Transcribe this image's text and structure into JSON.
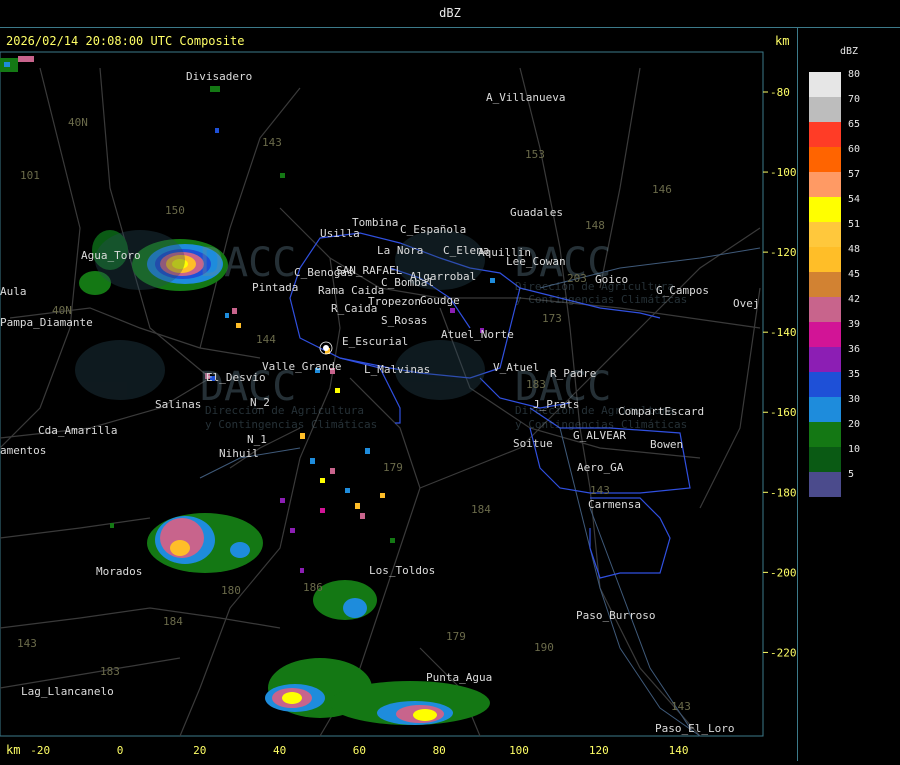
{
  "header": {
    "title": "dBZ"
  },
  "map": {
    "timestamp": "2026/02/14 20:08:00 UTC Composite",
    "km_label": "km",
    "x_ticks": [
      "-20",
      "0",
      "20",
      "40",
      "60",
      "80",
      "100",
      "120",
      "140"
    ],
    "y_ticks": [
      "-80",
      "-100",
      "-120",
      "-140",
      "-160",
      "-180",
      "-200",
      "-220"
    ],
    "places": [
      "Divisadero",
      "A_Villanueva",
      "Guadales",
      "Usilla",
      "Tombina",
      "C_Española",
      "La Nora",
      "C_Elena",
      "Aquillin",
      "Lee_Cowan",
      "Goico",
      "G_Campos",
      "Ovej",
      "Rama Caida",
      "SAN_RAFAEL",
      "C_Benogas",
      "C_Bombal",
      "Algarrobal",
      "Tropezon",
      "Goudge",
      "R_Caida",
      "S_Rosas",
      "Atuel_Norte",
      "Pintada",
      "E_Escurial",
      "V_Atuel",
      "R_Padre",
      "J_Prats",
      "CompartEscard",
      "Valle_Grande",
      "L_Malvinas",
      "El_Desvio",
      "Salinas",
      "N_2",
      "N_1",
      "Nihuil",
      "G_ALVEAR",
      "Bowen",
      "Soitue",
      "Aero_GA",
      "Carmensa",
      "Agua_Toro",
      "Pampa_Diamante",
      "Cda_Amarilla",
      "Los_Toldos",
      "Morados",
      "Paso_Burroso",
      "Punta_Agua",
      "Lag_Llancanelo",
      "Paso_El_Loro",
      "Aula",
      "amentos"
    ],
    "route_labels": [
      "101",
      "40N",
      "40N",
      "143",
      "153",
      "150",
      "146",
      "148",
      "203",
      "173",
      "144",
      "183",
      "179",
      "184",
      "186",
      "180",
      "184",
      "183",
      "190",
      "179",
      "143",
      "143",
      "143"
    ],
    "watermark": {
      "brand": "DACC",
      "line1": "Dirección de Agricultura",
      "line2": "y Contingencias Climáticas"
    }
  },
  "legend": {
    "title": "dBZ",
    "entries": [
      {
        "label": "80",
        "color": "#e6e6e6"
      },
      {
        "label": "70",
        "color": "#bdbdbd"
      },
      {
        "label": "65",
        "color": "#ff3c26"
      },
      {
        "label": "60",
        "color": "#ff6400"
      },
      {
        "label": "57",
        "color": "#ff9a64"
      },
      {
        "label": "54",
        "color": "#ffff00"
      },
      {
        "label": "51",
        "color": "#ffc83c"
      },
      {
        "label": "48",
        "color": "#ffbe28"
      },
      {
        "label": "45",
        "color": "#d28232"
      },
      {
        "label": "42",
        "color": "#c8648c"
      },
      {
        "label": "39",
        "color": "#d21496"
      },
      {
        "label": "36",
        "color": "#8c1eb4"
      },
      {
        "label": "35",
        "color": "#1e50d7"
      },
      {
        "label": "30",
        "color": "#1e8cdc"
      },
      {
        "label": "20",
        "color": "#147814"
      },
      {
        "label": "10",
        "color": "#0a5a14"
      },
      {
        "label": "5",
        "color": "#4b4b8c"
      }
    ]
  }
}
